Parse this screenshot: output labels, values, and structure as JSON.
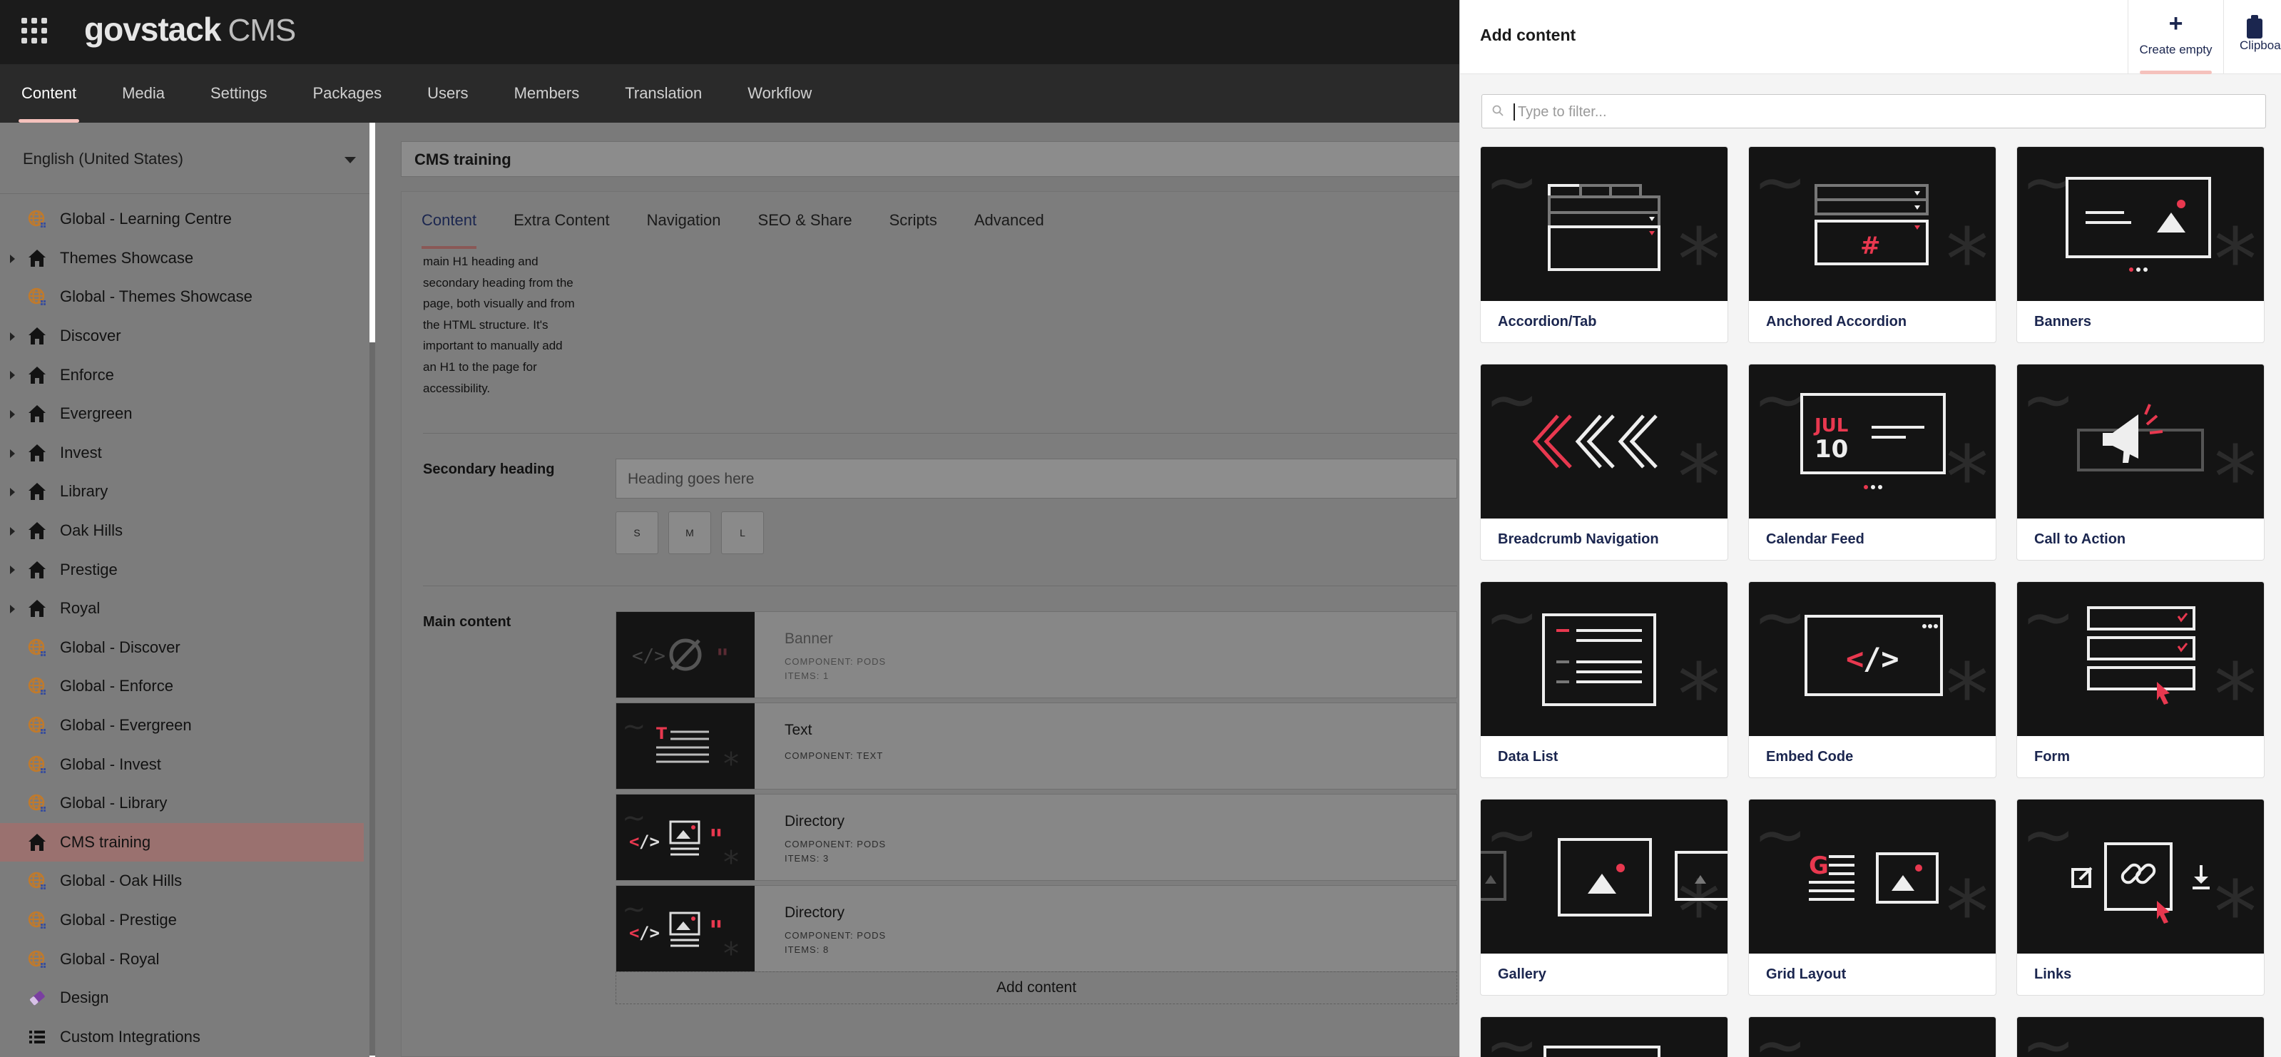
{
  "header": {
    "logo": "govstack",
    "product": "CMS"
  },
  "topnav": [
    "Content",
    "Media",
    "Settings",
    "Packages",
    "Users",
    "Members",
    "Translation",
    "Workflow"
  ],
  "sidebar": {
    "language": "English (United States)",
    "tree": [
      {
        "label": "Global - Learning Centre",
        "icon": "globe-icon",
        "expandable": false
      },
      {
        "label": "Themes Showcase",
        "icon": "home-icon",
        "expandable": true
      },
      {
        "label": "Global - Themes Showcase",
        "icon": "globe-icon",
        "expandable": false
      },
      {
        "label": "Discover",
        "icon": "home-icon",
        "expandable": true
      },
      {
        "label": "Enforce",
        "icon": "home-icon",
        "expandable": true
      },
      {
        "label": "Evergreen",
        "icon": "home-icon",
        "expandable": true
      },
      {
        "label": "Invest",
        "icon": "home-icon",
        "expandable": true
      },
      {
        "label": "Library",
        "icon": "home-icon",
        "expandable": true
      },
      {
        "label": "Oak Hills",
        "icon": "home-icon",
        "expandable": true
      },
      {
        "label": "Prestige",
        "icon": "home-icon",
        "expandable": true
      },
      {
        "label": "Royal",
        "icon": "home-icon",
        "expandable": true
      },
      {
        "label": "Global - Discover",
        "icon": "globe-icon",
        "expandable": false
      },
      {
        "label": "Global - Enforce",
        "icon": "globe-icon",
        "expandable": false
      },
      {
        "label": "Global - Evergreen",
        "icon": "globe-icon",
        "expandable": false
      },
      {
        "label": "Global - Invest",
        "icon": "globe-icon",
        "expandable": false
      },
      {
        "label": "Global - Library",
        "icon": "globe-icon",
        "expandable": false
      },
      {
        "label": "CMS training",
        "icon": "home-icon",
        "expandable": false,
        "selected": true
      },
      {
        "label": "Global - Oak Hills",
        "icon": "globe-icon",
        "expandable": false
      },
      {
        "label": "Global - Prestige",
        "icon": "globe-icon",
        "expandable": false
      },
      {
        "label": "Global - Royal",
        "icon": "globe-icon",
        "expandable": false
      },
      {
        "label": "Design",
        "icon": "eraser-icon",
        "expandable": false
      },
      {
        "label": "Custom Integrations",
        "icon": "list-icon",
        "expandable": false
      }
    ]
  },
  "editor": {
    "page_title": "CMS training",
    "tabs": [
      "Content",
      "Extra Content",
      "Navigation",
      "SEO & Share",
      "Scripts",
      "Advanced"
    ],
    "description_lines": [
      "main H1 heading and",
      "secondary heading from the",
      "page, both visually and from",
      "the HTML structure. It's",
      "important to manually add",
      "an H1 to the page for",
      "accessibility."
    ],
    "secondary_heading_label": "Secondary heading",
    "secondary_heading_placeholder": "Heading goes here",
    "sizes": [
      "S",
      "M",
      "L"
    ],
    "main_content_label": "Main content",
    "blocks": [
      {
        "name": "Banner",
        "component": "COMPONENT: PODS",
        "items": "ITEMS: 1",
        "faded": true
      },
      {
        "name": "Text",
        "component": "COMPONENT: TEXT",
        "items": ""
      },
      {
        "name": "Directory",
        "component": "COMPONENT: PODS",
        "items": "ITEMS: 3"
      },
      {
        "name": "Directory",
        "component": "COMPONENT: PODS",
        "items": "ITEMS: 8"
      }
    ],
    "add_content": "Add content"
  },
  "drawer": {
    "title": "Add content",
    "create_empty": "Create empty",
    "clipboard": "Clipboard",
    "filter_placeholder": "Type to filter...",
    "accent": "#e8384f",
    "cards": [
      "Accordion/Tab",
      "Anchored Accordion",
      "Banners",
      "Breadcrumb Navigation",
      "Calendar Feed",
      "Call to Action",
      "Data List",
      "Embed Code",
      "Form",
      "Gallery",
      "Grid Layout",
      "Links"
    ],
    "calendar_month": "JUL",
    "calendar_day": "10"
  }
}
